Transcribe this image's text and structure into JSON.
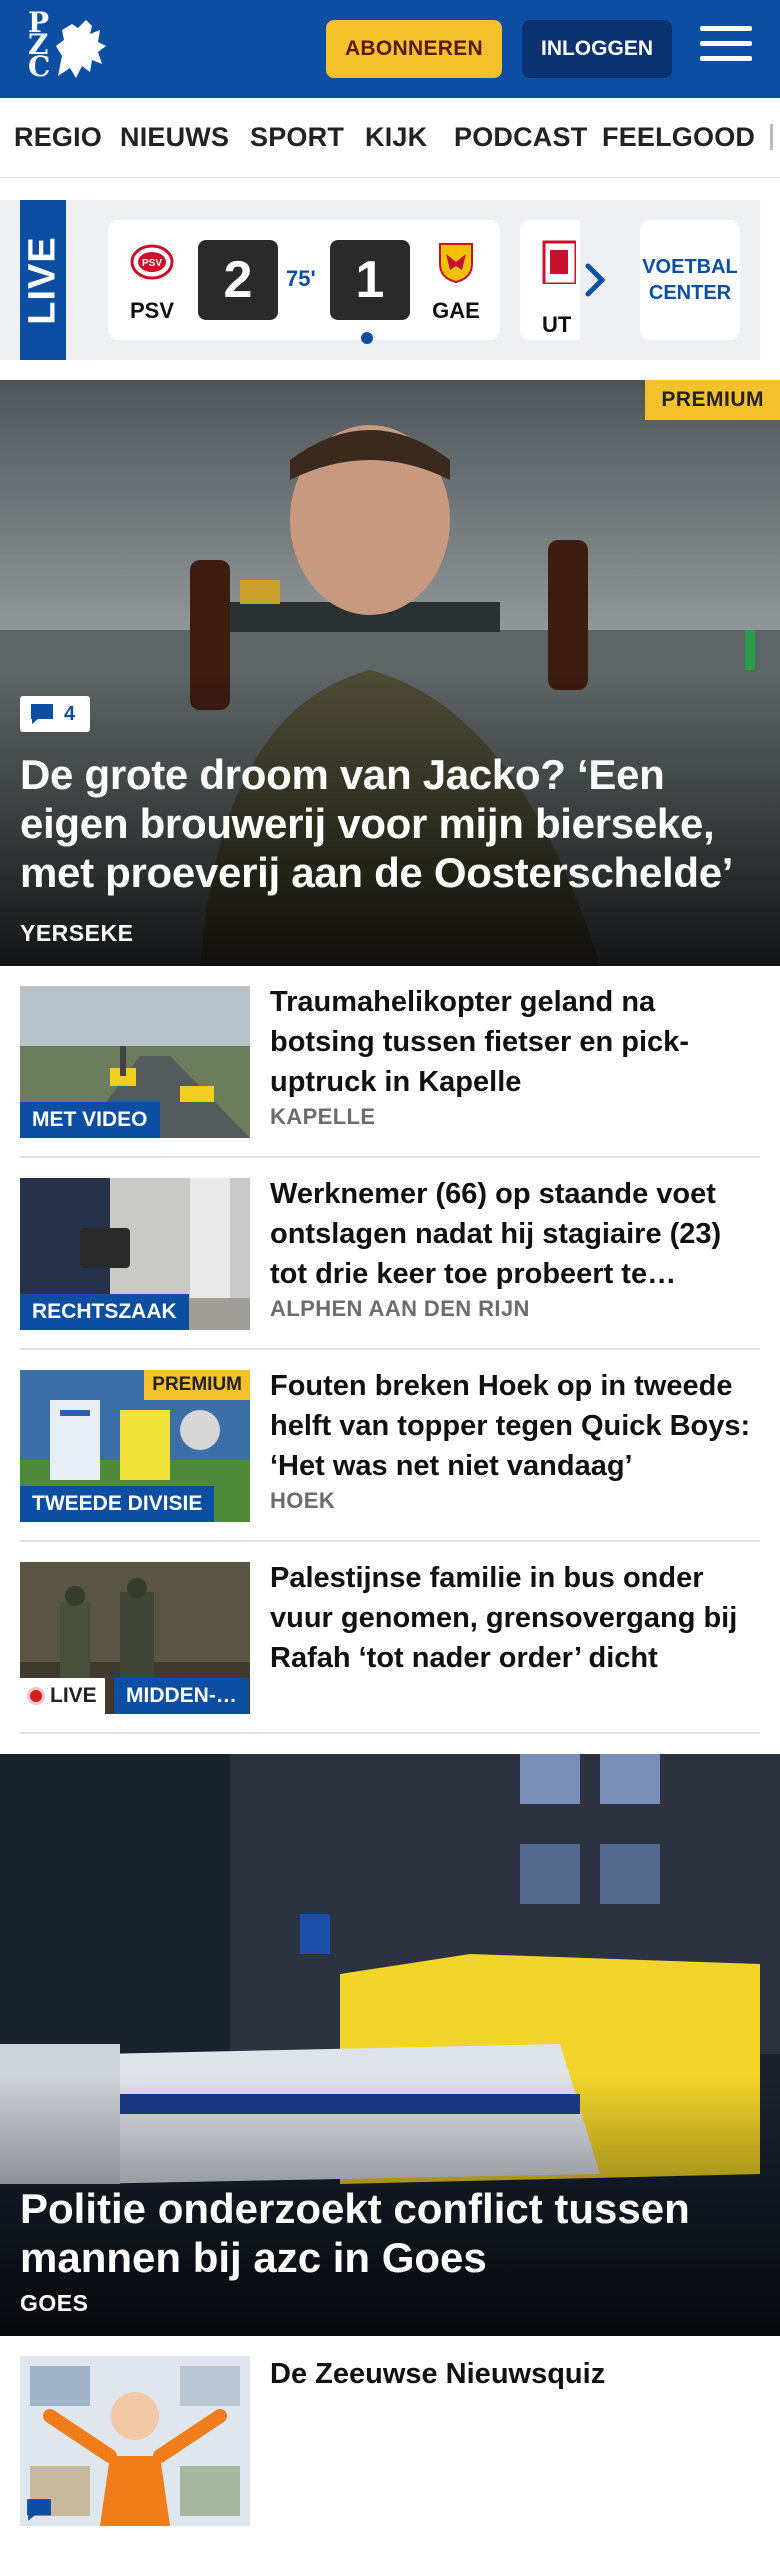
{
  "header": {
    "logo_text": "PZC",
    "subscribe_label": "ABONNEREN",
    "login_label": "INLOGGEN",
    "brand_color": "#0c4ea2"
  },
  "nav": {
    "items": [
      {
        "label": "REGIO"
      },
      {
        "label": "NIEUWS"
      },
      {
        "label": "SPORT"
      },
      {
        "label": "KIJK"
      },
      {
        "label": "PODCAST"
      },
      {
        "label": "FEELGOOD"
      }
    ]
  },
  "live": {
    "label": "LIVE",
    "match": {
      "home": "PSV",
      "away": "GAE",
      "home_score": "2",
      "away_score": "1",
      "minute": "75'"
    },
    "next_match_team": "UT",
    "voetbal_center": "VOETBAL CENTER"
  },
  "hero": {
    "premium": "PREMIUM",
    "comments": "4",
    "title": "De grote droom van Jacko? ‘Een eigen brouwerij voor mijn bierseke, met proeverij aan de Oosterschelde’",
    "location": "YERSEKE"
  },
  "articles": [
    {
      "label": "MET VIDEO",
      "title": "Traumahelikopter geland na botsing tussen fietser en pick-uptruck in Kapelle",
      "location": "KAPELLE"
    },
    {
      "label": "RECHTSZAAK",
      "title": "Werknemer (66) op staande voet ontslagen nadat hij stagiaire (23) tot drie keer toe probeert te…",
      "location": "ALPHEN AAN DEN RIJN"
    },
    {
      "label": "TWEEDE DIVISIE",
      "premium": "PREMIUM",
      "title": "Fouten breken Hoek op in tweede helft van topper tegen Quick Boys: ‘Het was net niet vandaag’",
      "location": "HOEK"
    },
    {
      "live": "LIVE",
      "label": "MIDDEN-…",
      "title": "Palestijnse familie in bus onder vuur genomen, grensovergang bij Rafah ‘tot nader order’ dicht"
    }
  ],
  "hero2": {
    "title": "Politie onderzoekt conflict tussen mannen bij azc in Goes",
    "location": "GOES"
  },
  "quiz": {
    "title": "De Zeeuwse Nieuwsquiz"
  }
}
